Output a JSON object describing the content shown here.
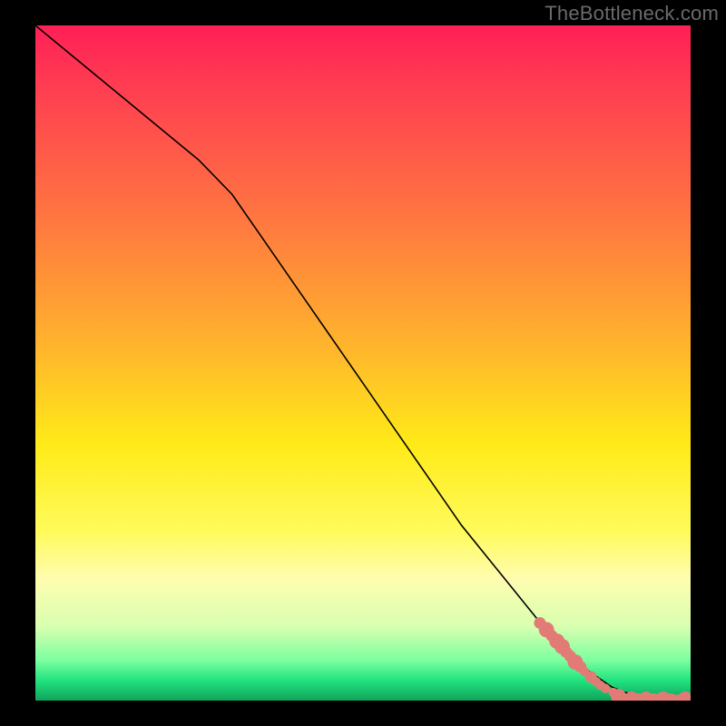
{
  "watermark": "TheBottleneck.com",
  "chart_data": {
    "type": "line",
    "title": "",
    "xlabel": "",
    "ylabel": "",
    "xlim": [
      0,
      100
    ],
    "ylim": [
      0,
      100
    ],
    "grid": false,
    "legend": false,
    "series": [
      {
        "name": "curve",
        "style": "solid-black",
        "x": [
          0,
          5,
          10,
          15,
          20,
          25,
          30,
          35,
          40,
          45,
          50,
          55,
          60,
          65,
          70,
          75,
          80,
          82,
          85,
          88,
          90,
          92,
          95,
          100
        ],
        "y": [
          100,
          96,
          92,
          88,
          84,
          80,
          75,
          68,
          61,
          54,
          47,
          40,
          33,
          26,
          20,
          14,
          8,
          6,
          4,
          2,
          1.2,
          0.8,
          0.3,
          0
        ]
      },
      {
        "name": "markers",
        "style": "salmon-dots",
        "points": [
          {
            "x": 77.0,
            "y": 11.5,
            "r": 1.0
          },
          {
            "x": 78.0,
            "y": 10.5,
            "r": 1.3
          },
          {
            "x": 78.8,
            "y": 9.6,
            "r": 1.0
          },
          {
            "x": 79.6,
            "y": 8.8,
            "r": 1.3
          },
          {
            "x": 80.4,
            "y": 8.0,
            "r": 1.3
          },
          {
            "x": 81.0,
            "y": 7.2,
            "r": 1.0
          },
          {
            "x": 81.6,
            "y": 6.6,
            "r": 1.0
          },
          {
            "x": 82.4,
            "y": 5.7,
            "r": 1.3
          },
          {
            "x": 83.2,
            "y": 5.0,
            "r": 1.0
          },
          {
            "x": 83.8,
            "y": 4.3,
            "r": 0.8
          },
          {
            "x": 84.8,
            "y": 3.5,
            "r": 1.0
          },
          {
            "x": 85.6,
            "y": 2.8,
            "r": 0.8
          },
          {
            "x": 86.2,
            "y": 2.3,
            "r": 0.8
          },
          {
            "x": 87.0,
            "y": 1.8,
            "r": 0.8
          },
          {
            "x": 88.2,
            "y": 1.2,
            "r": 0.8
          },
          {
            "x": 89.0,
            "y": 0.6,
            "r": 1.3
          },
          {
            "x": 90.0,
            "y": 0.2,
            "r": 1.0
          },
          {
            "x": 91.0,
            "y": 0.2,
            "r": 1.3
          },
          {
            "x": 92.0,
            "y": 0.2,
            "r": 1.0
          },
          {
            "x": 93.2,
            "y": 0.2,
            "r": 1.3
          },
          {
            "x": 94.4,
            "y": 0.2,
            "r": 1.0
          },
          {
            "x": 95.0,
            "y": 0.2,
            "r": 0.8
          },
          {
            "x": 95.8,
            "y": 0.2,
            "r": 1.3
          },
          {
            "x": 97.0,
            "y": 0.2,
            "r": 1.0
          },
          {
            "x": 98.0,
            "y": 0.2,
            "r": 0.8
          },
          {
            "x": 99.2,
            "y": 0.2,
            "r": 1.3
          }
        ]
      }
    ],
    "background_bands_note": "vertical gradient from red (top, y≈100) through orange/yellow to green (bottom, y≈0)"
  },
  "colors": {
    "marker": "#e27b76",
    "line": "#000000",
    "frame_bg": "#000000"
  }
}
